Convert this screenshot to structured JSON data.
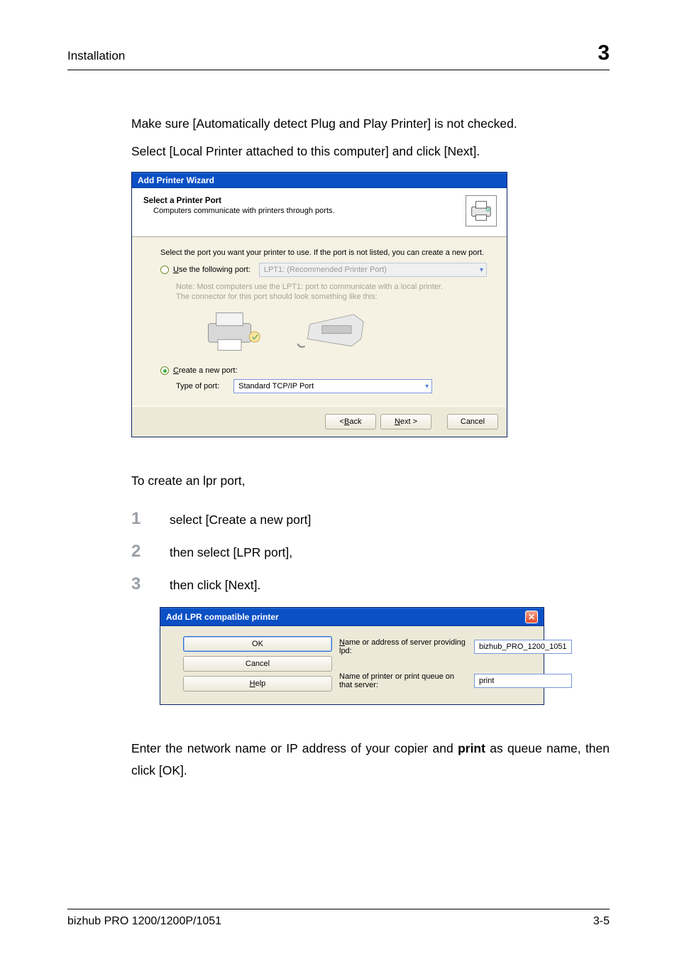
{
  "header": {
    "section": "Installation",
    "chapter": "3"
  },
  "intro": {
    "line1": "Make sure [Automatically detect Plug and Play Printer] is not checked.",
    "line2": "Select [Local Printer attached to this computer] and click [Next]."
  },
  "wizard": {
    "title": "Add Printer Wizard",
    "heading": "Select a Printer Port",
    "subheading": "Computers communicate with printers through ports.",
    "instruction": "Select the port you want your printer to use.  If the port is not listed, you can create a new port.",
    "use_port_prefix": "U",
    "use_port_rest": "se the following port:",
    "use_port_value": "LPT1: (Recommended Printer Port)",
    "note_line1": "Note: Most computers use the LPT1: port to communicate with a local printer.",
    "note_line2": "The connector for this port should look something like this:",
    "create_port_prefix": "C",
    "create_port_rest": "reate a new port:",
    "type_label": "Type of port:",
    "type_value": "Standard TCP/IP Port",
    "btn_back_prefix": "< ",
    "btn_back_u": "B",
    "btn_back_rest": "ack",
    "btn_next_u": "N",
    "btn_next_rest": "ext >",
    "btn_cancel": "Cancel"
  },
  "middle": {
    "lead": "To create an lpr port,",
    "steps": [
      {
        "n": "1",
        "t": "select [Create a new port]"
      },
      {
        "n": "2",
        "t": "then select [LPR port],"
      },
      {
        "n": "3",
        "t": "then click [Next]."
      }
    ]
  },
  "lpr": {
    "title": "Add LPR compatible printer",
    "label1_u": "N",
    "label1_rest": "ame or address of server providing lpd:",
    "value1": "bizhub_PRO_1200_1051",
    "label2": "Name of printer or print queue on that server:",
    "value2": "print",
    "ok": "OK",
    "cancel": "Cancel",
    "help_u": "H",
    "help_rest": "elp"
  },
  "outro": {
    "text_before": "Enter the network name or IP address of your copier and ",
    "bold": "print",
    "text_after": " as queue name, then click [OK]."
  },
  "footer": {
    "left": "bizhub PRO 1200/1200P/1051",
    "right": "3-5"
  }
}
